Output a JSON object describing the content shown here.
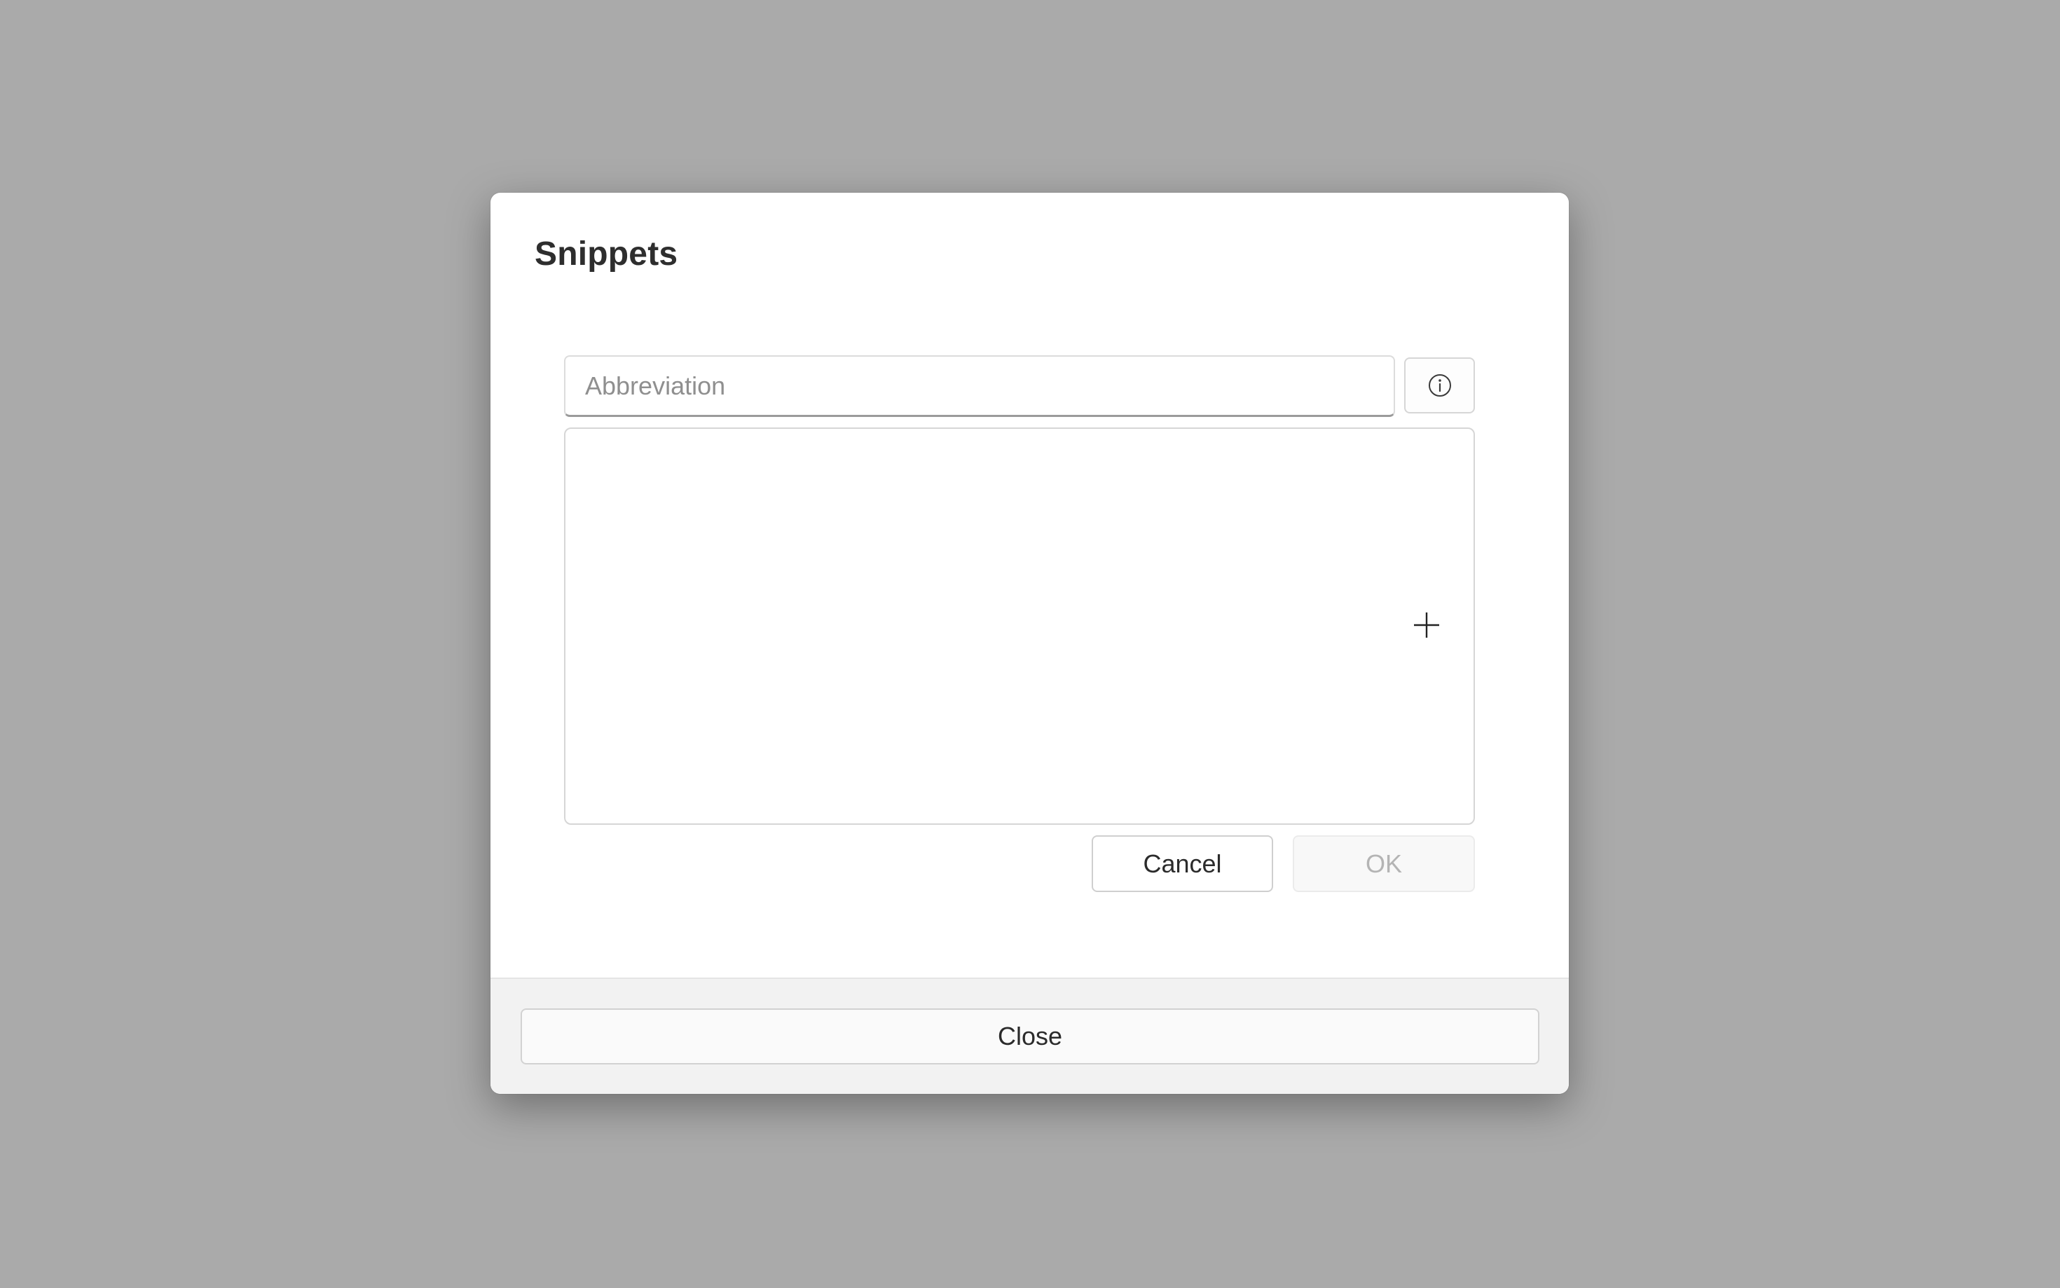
{
  "dialog": {
    "title": "Snippets",
    "abbreviation": {
      "value": "",
      "placeholder": "Abbreviation"
    },
    "info_icon": "info-circle-icon",
    "add_icon": "plus-icon",
    "cancel_label": "Cancel",
    "ok_label": "OK",
    "ok_enabled": false,
    "close_label": "Close"
  },
  "colors": {
    "backdrop": "#aaaaaa",
    "dialog_background": "#ffffff",
    "footer_background": "#f2f2f2",
    "disabled_text": "#b4b4b4"
  }
}
